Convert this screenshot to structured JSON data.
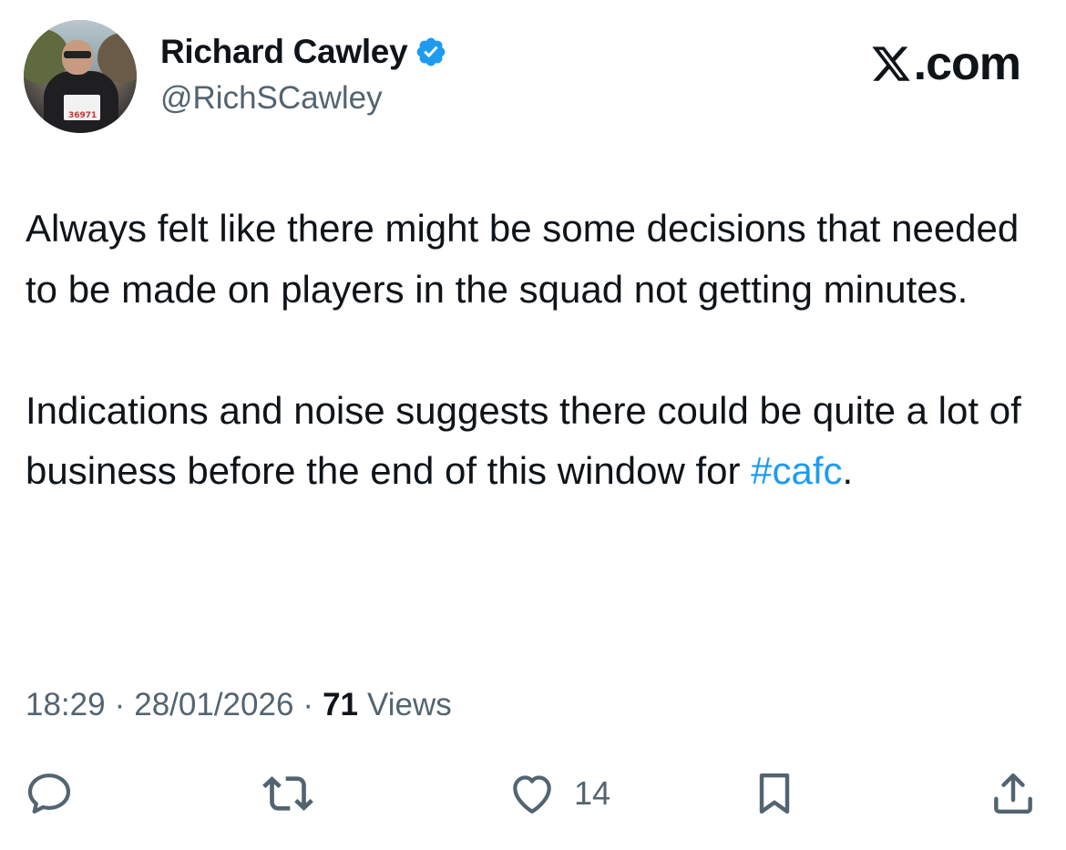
{
  "author": {
    "display_name": "Richard Cawley",
    "handle": "@RichSCawley",
    "verified": true,
    "avatar_bib_number": "36971"
  },
  "brand": {
    "site": ".com",
    "logo_icon": "x-logo-icon"
  },
  "tweet": {
    "paragraph1": "Always felt like there might be some decisions that needed to be made on players in the squad not getting minutes.",
    "paragraph2_text": "Indications and noise suggests there could be quite a lot of business before the end of this window for ",
    "hashtag": "#cafc",
    "paragraph2_end": "."
  },
  "meta": {
    "time": "18:29",
    "separator": "·",
    "date": "28/01/2026",
    "views_count": "71",
    "views_label": "Views"
  },
  "actions": {
    "reply": {
      "icon": "reply-icon",
      "count": ""
    },
    "repost": {
      "icon": "repost-icon",
      "count": ""
    },
    "like": {
      "icon": "heart-icon",
      "count": "14"
    },
    "bookmark": {
      "icon": "bookmark-icon",
      "count": ""
    },
    "share": {
      "icon": "share-icon",
      "count": ""
    }
  },
  "colors": {
    "text": "#0f1419",
    "secondary": "#536471",
    "link": "#1d9bf0",
    "verified": "#1d9bf0"
  }
}
